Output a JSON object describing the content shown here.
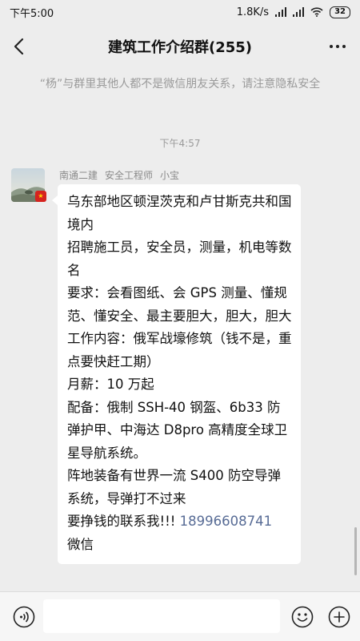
{
  "status_bar": {
    "time": "下午5:00",
    "net_speed": "1.8K/s",
    "battery": "32"
  },
  "header": {
    "title": "建筑工作介绍群(255)"
  },
  "notice": {
    "text": "“杨”与群里其他人都不是微信朋友关系，请注意隐私安全"
  },
  "chat": {
    "time_divider": "下午4:57",
    "message": {
      "sender_company": "南通二建",
      "sender_title": "安全工程师",
      "sender_name": "小宝",
      "lines": [
        "乌东部地区顿涅茨克和卢甘斯克共和国境内",
        "招聘施工员，安全员，测量，机电等数名",
        "要求：会看图纸、会 GPS 测量、懂规范、懂安全、最主要胆大，胆大，胆大",
        "工作内容：俄军战壕修筑（钱不是，重点要快赶工期）",
        "月薪：10 万起",
        "配备：俄制 SSH-40 钢盔、6b33 防弹护甲、中海达 D8pro 高精度全球卫星导航系统。",
        "阵地装备有世界一流 S400 防空导弹系统，导弹打不过来"
      ],
      "contact_prefix": "要挣钱的联系我!!! ",
      "phone": "18996608741",
      "contact_suffix": "微信"
    }
  },
  "input_bar": {
    "placeholder": ""
  }
}
